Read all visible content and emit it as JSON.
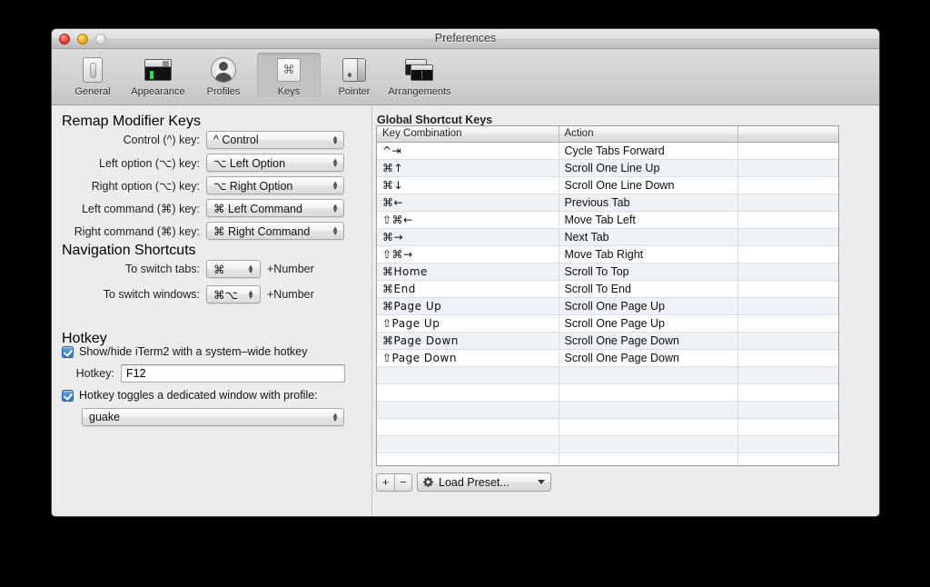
{
  "window": {
    "title": "Preferences",
    "traffic_lights": [
      "close-button",
      "minimize-button",
      "zoom-button"
    ]
  },
  "toolbar": {
    "items": [
      {
        "label": "General",
        "icon": "display-brightness-icon",
        "selected": false
      },
      {
        "label": "Appearance",
        "icon": "terminal-window-icon",
        "selected": false
      },
      {
        "label": "Profiles",
        "icon": "user-silhouette-icon",
        "selected": false
      },
      {
        "label": "Keys",
        "icon": "command-key-icon",
        "selected": true
      },
      {
        "label": "Pointer",
        "icon": "mouse-icon",
        "selected": false
      },
      {
        "label": "Arrangements",
        "icon": "stacked-windows-icon",
        "selected": false
      }
    ]
  },
  "left_panel": {
    "remap_section": {
      "heading": "Remap Modifier Keys",
      "rows": [
        {
          "label": "Control (^) key:",
          "value": "^ Control"
        },
        {
          "label": "Left option (⌥) key:",
          "value": "⌥ Left Option"
        },
        {
          "label": "Right option (⌥) key:",
          "value": "⌥ Right Option"
        },
        {
          "label": "Left command (⌘) key:",
          "value": "⌘ Left Command"
        },
        {
          "label": "Right command (⌘) key:",
          "value": "⌘ Right Command"
        }
      ]
    },
    "navigation_section": {
      "heading": "Navigation Shortcuts",
      "rows": [
        {
          "label": "To switch tabs:",
          "value": "⌘",
          "suffix": "+Number"
        },
        {
          "label": "To switch windows:",
          "value": "⌘⌥",
          "suffix": "+Number"
        }
      ]
    },
    "hotkey_section": {
      "heading": "Hotkey",
      "enable_checkbox_label": "Show/hide iTerm2 with a system–wide hotkey",
      "enable_checkbox_checked": true,
      "hotkey_field_label": "Hotkey:",
      "hotkey_field_value": "F12",
      "dedicated_checkbox_label": "Hotkey toggles a dedicated window with profile:",
      "dedicated_checkbox_checked": true,
      "profile_value": "guake"
    }
  },
  "right_panel": {
    "heading": "Global Shortcut Keys",
    "table": {
      "columns": [
        "Key Combination",
        "Action",
        ""
      ],
      "rows": [
        [
          "^⇥",
          "Cycle Tabs Forward",
          ""
        ],
        [
          "⌘↑",
          "Scroll One Line Up",
          ""
        ],
        [
          "⌘↓",
          "Scroll One Line Down",
          ""
        ],
        [
          "⌘←",
          "Previous Tab",
          ""
        ],
        [
          "⇧⌘←",
          "Move Tab Left",
          ""
        ],
        [
          "⌘→",
          "Next Tab",
          ""
        ],
        [
          "⇧⌘→",
          "Move Tab Right",
          ""
        ],
        [
          "⌘Home",
          "Scroll To Top",
          ""
        ],
        [
          "⌘End",
          "Scroll To End",
          ""
        ],
        [
          "⌘Page Up",
          "Scroll One Page Up",
          ""
        ],
        [
          "⇧Page Up",
          "Scroll One Page Up",
          ""
        ],
        [
          "⌘Page Down",
          "Scroll One Page Down",
          ""
        ],
        [
          "⇧Page Down",
          "Scroll One Page Down",
          ""
        ],
        [
          "",
          "",
          ""
        ],
        [
          "",
          "",
          ""
        ],
        [
          "",
          "",
          ""
        ],
        [
          "",
          "",
          ""
        ],
        [
          "",
          "",
          ""
        ],
        [
          "",
          "",
          ""
        ]
      ]
    },
    "bottom_bar": {
      "add_label": "+",
      "remove_label": "−",
      "preset_label": "Load Preset...",
      "preset_icon": "gear-icon"
    }
  },
  "colors": {
    "window_bg": "#ececec",
    "stripe": "#eff2f7",
    "checkbox_accent": "#2f72c9",
    "title_text": "#3a3a3a"
  }
}
